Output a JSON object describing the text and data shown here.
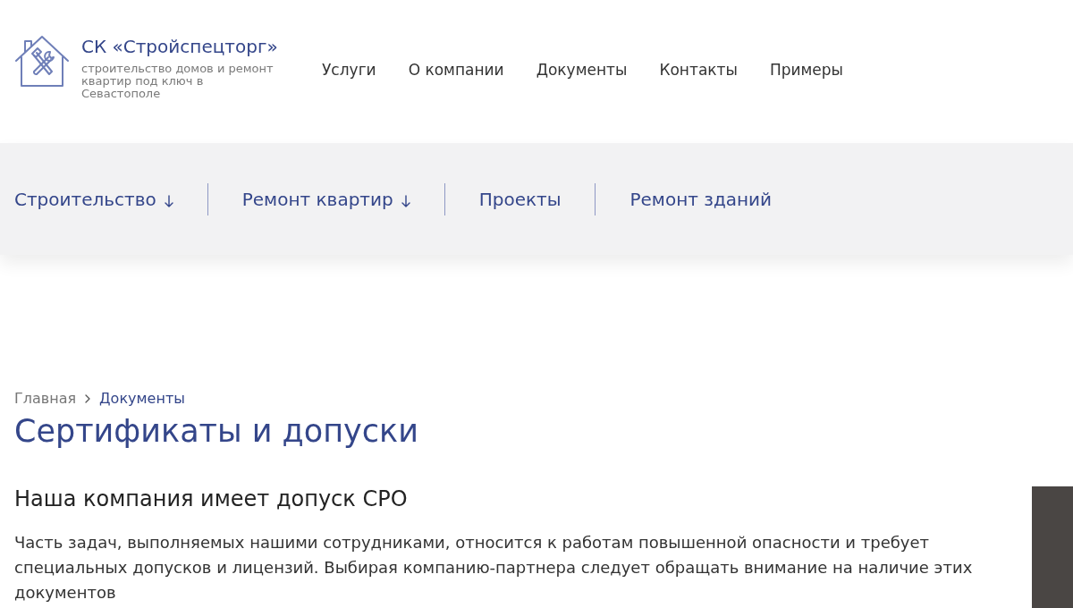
{
  "logo": {
    "title": "СК «Стройспецторг»",
    "subtitle": "строительство домов и ремонт квартир под ключ в Севастополе"
  },
  "top_nav": [
    "Услуги",
    "О компании",
    "Документы",
    "Контакты",
    "Примеры"
  ],
  "category_nav": [
    {
      "label": "Строительство",
      "dropdown": true
    },
    {
      "label": "Ремонт квартир",
      "dropdown": true
    },
    {
      "label": "Проекты",
      "dropdown": false
    },
    {
      "label": "Ремонт зданий",
      "dropdown": false
    }
  ],
  "breadcrumb": [
    {
      "label": "Главная",
      "current": false
    },
    {
      "label": "Документы",
      "current": true
    }
  ],
  "page_title": "Сертификаты и допуски",
  "section": {
    "heading": "Наша компания имеет допуск СРО",
    "text": "Часть задач, выполняемых нашими сотрудниками, относится к работам повышенной опасности и требует специальных допусков и лицензий. Выбирая компанию-партнера следует обращать внимание на наличие этих документов"
  }
}
